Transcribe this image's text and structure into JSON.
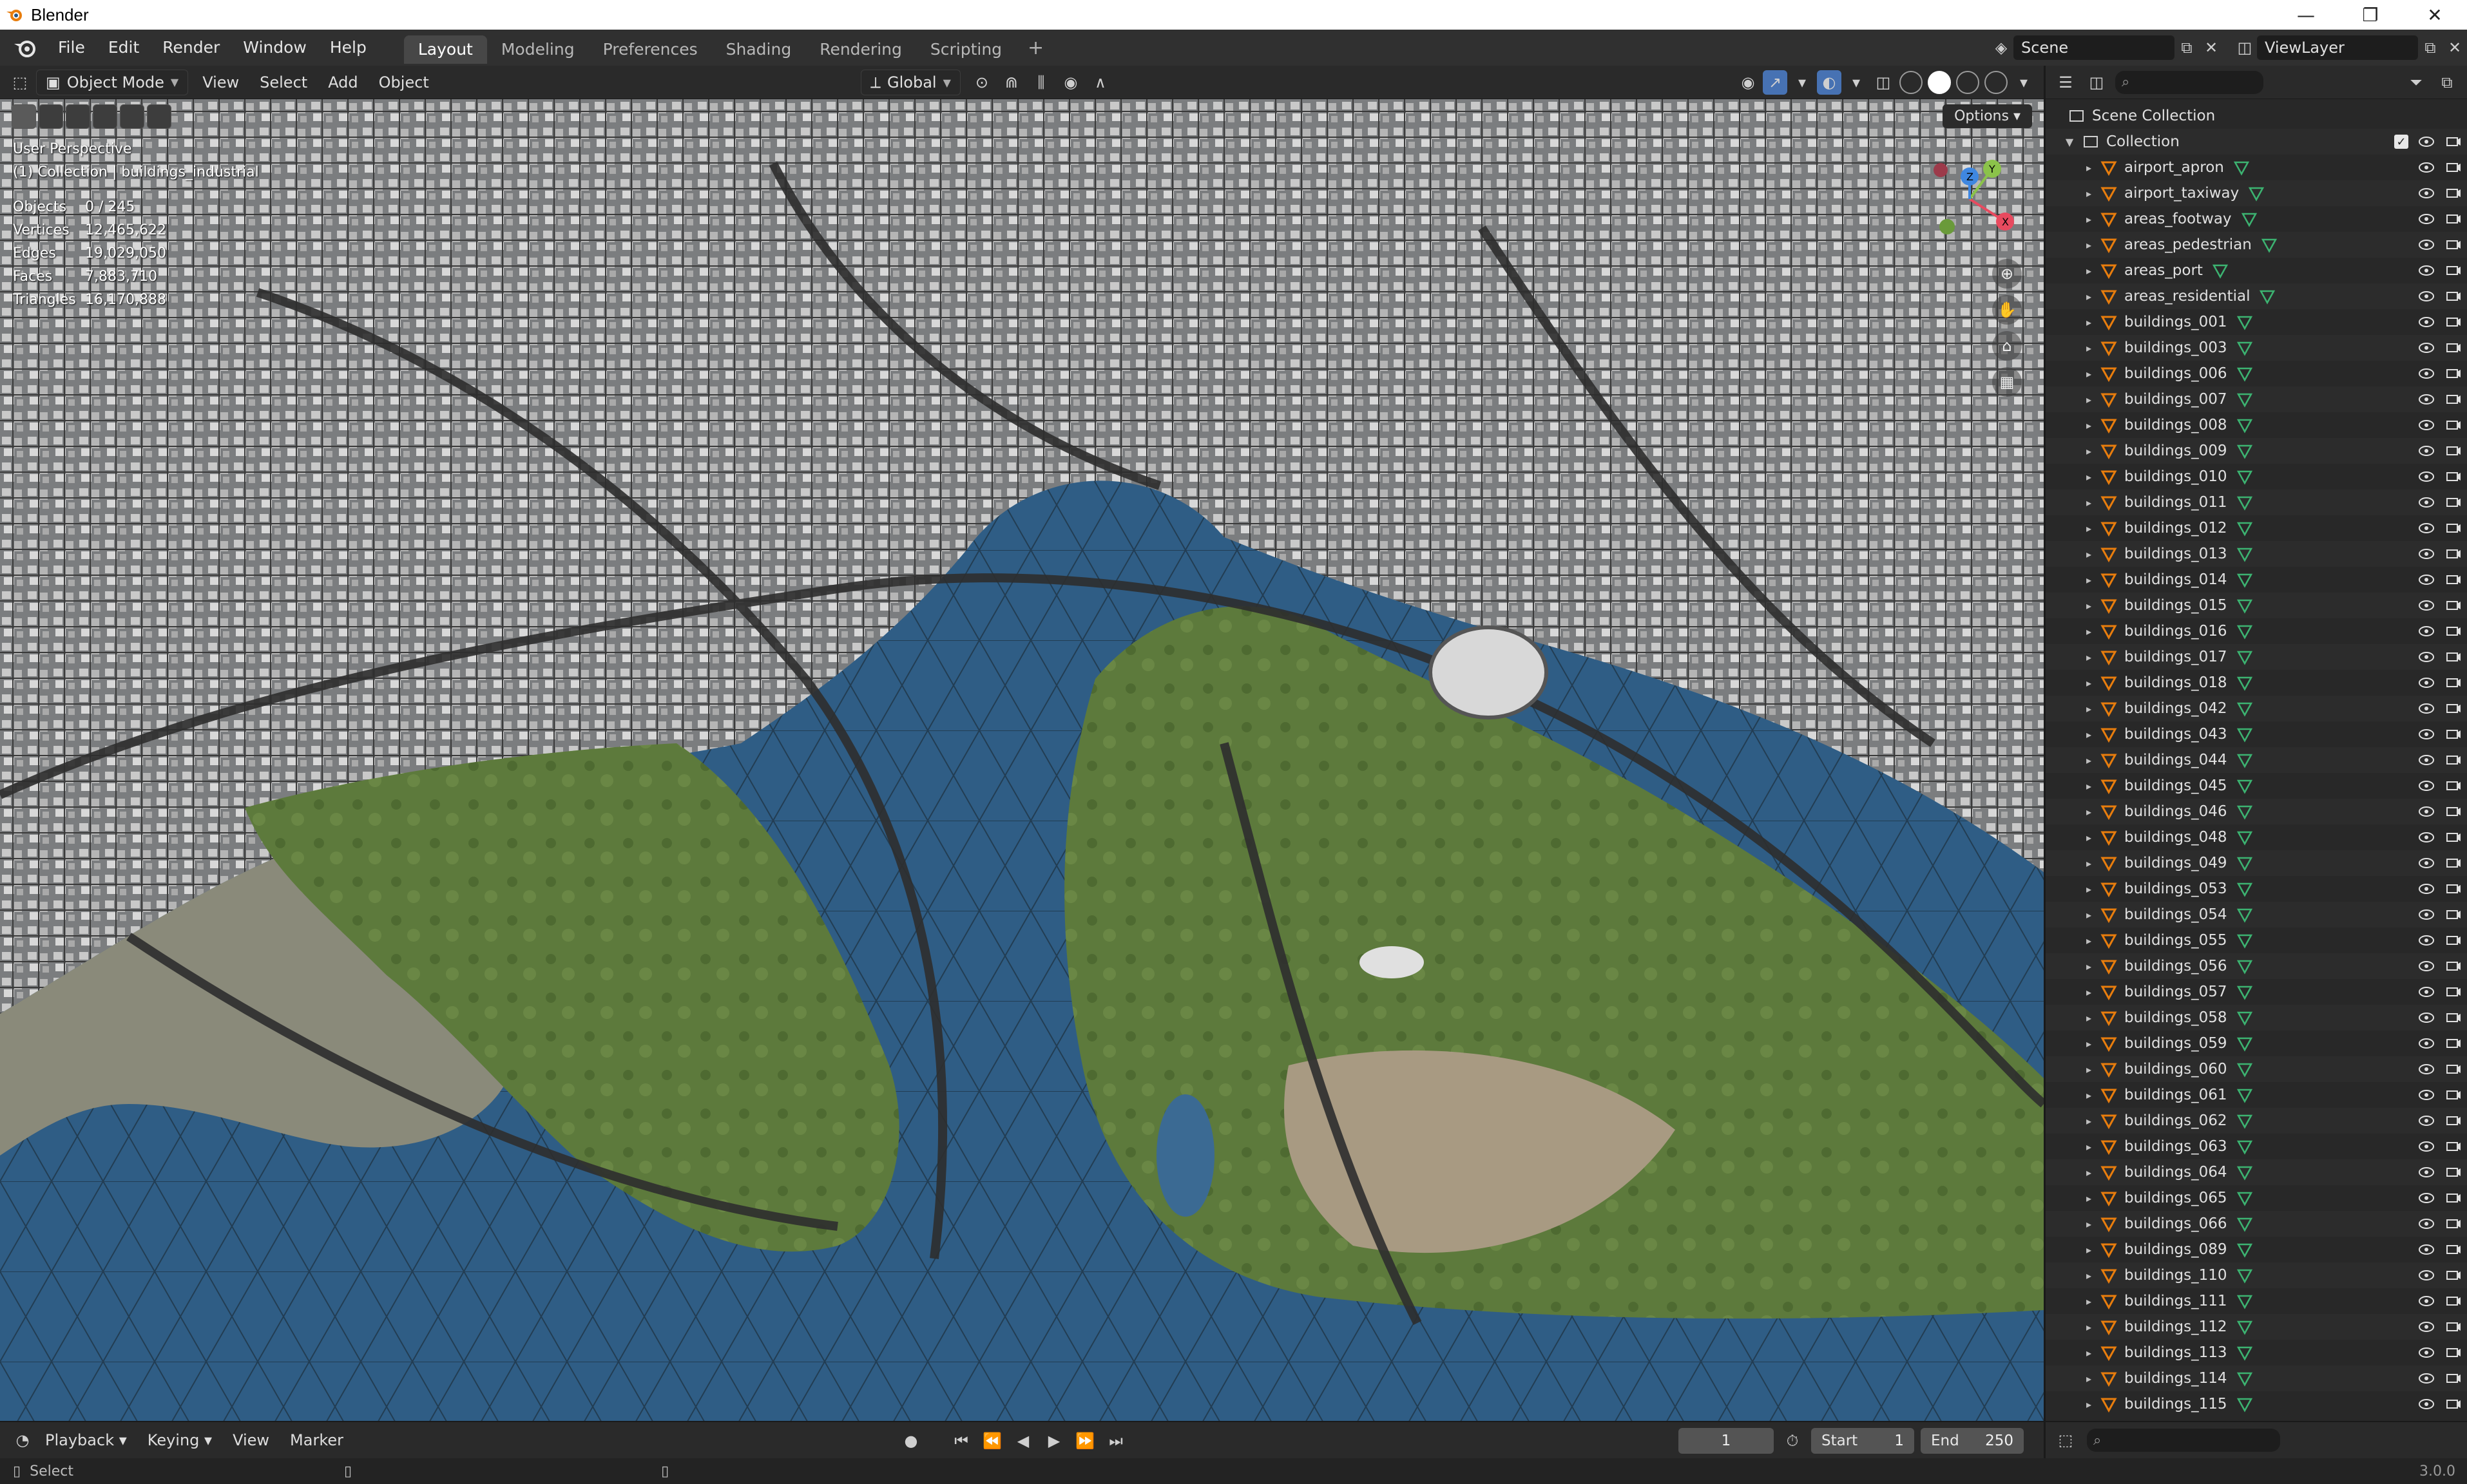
{
  "window": {
    "title": "Blender",
    "minimize": "—",
    "maximize": "❐",
    "close": "✕"
  },
  "menus": [
    "File",
    "Edit",
    "Render",
    "Window",
    "Help"
  ],
  "workspaces": [
    {
      "label": "Layout",
      "active": true
    },
    {
      "label": "Modeling"
    },
    {
      "label": "Preferences"
    },
    {
      "label": "Shading"
    },
    {
      "label": "Rendering"
    },
    {
      "label": "Scripting"
    }
  ],
  "workspace_add": "+",
  "scene": {
    "name": "Scene",
    "view_layer": "ViewLayer"
  },
  "viewport_header": {
    "mode": "Object Mode",
    "menus": [
      "View",
      "Select",
      "Add",
      "Object"
    ],
    "transform_orientation": "Global",
    "options": "Options"
  },
  "viewport": {
    "perspective": "User Perspective",
    "context": "(1) Collection | buildings_industrial",
    "stats": [
      {
        "label": "Objects",
        "value": "0 / 245"
      },
      {
        "label": "Vertices",
        "value": "12,465,622"
      },
      {
        "label": "Edges",
        "value": "19,029,050"
      },
      {
        "label": "Faces",
        "value": "7,883,710"
      },
      {
        "label": "Triangles",
        "value": "16,170,888"
      }
    ],
    "gizmo_axes": {
      "x": "X",
      "y": "Y",
      "z": "Z"
    }
  },
  "outliner": {
    "search_placeholder": "",
    "scene_collection": "Scene Collection",
    "collection": "Collection",
    "objects": [
      "airport_apron",
      "airport_taxiway",
      "areas_footway",
      "areas_pedestrian",
      "areas_port",
      "areas_residential",
      "buildings_001",
      "buildings_003",
      "buildings_006",
      "buildings_007",
      "buildings_008",
      "buildings_009",
      "buildings_010",
      "buildings_011",
      "buildings_012",
      "buildings_013",
      "buildings_014",
      "buildings_015",
      "buildings_016",
      "buildings_017",
      "buildings_018",
      "buildings_042",
      "buildings_043",
      "buildings_044",
      "buildings_045",
      "buildings_046",
      "buildings_048",
      "buildings_049",
      "buildings_053",
      "buildings_054",
      "buildings_055",
      "buildings_056",
      "buildings_057",
      "buildings_058",
      "buildings_059",
      "buildings_060",
      "buildings_061",
      "buildings_062",
      "buildings_063",
      "buildings_064",
      "buildings_065",
      "buildings_066",
      "buildings_089",
      "buildings_110",
      "buildings_111",
      "buildings_112",
      "buildings_113",
      "buildings_114",
      "buildings_115"
    ]
  },
  "timeline": {
    "menus": [
      "Playback",
      "Keying",
      "View",
      "Marker"
    ],
    "current_frame": "1",
    "start_label": "Start",
    "start": "1",
    "end_label": "End",
    "end": "250"
  },
  "statusbar": {
    "action": "Select",
    "version": "3.0.0"
  },
  "colors": {
    "accent": "#e87d0d",
    "mesh": "#3cb371",
    "water": "#2f5d85",
    "active_tab": "#474747"
  }
}
